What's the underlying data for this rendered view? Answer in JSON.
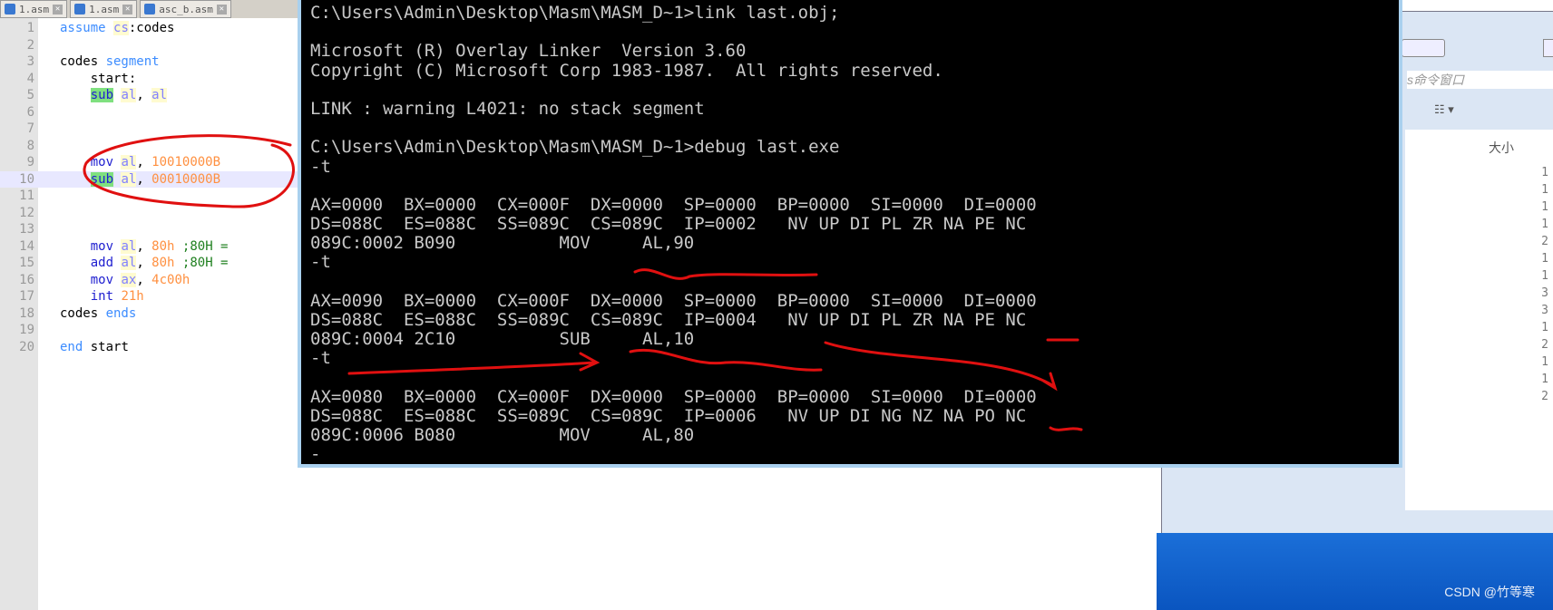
{
  "editor": {
    "tabs": [
      {
        "label": "1.asm"
      },
      {
        "label": "1.asm"
      },
      {
        "label": "asc_b.asm"
      }
    ],
    "lines": [
      {
        "n": "1",
        "html": "<span class='kw'>assume</span> <span class='reg'>cs</span>:codes"
      },
      {
        "n": "2",
        "html": ""
      },
      {
        "n": "3",
        "html": "codes <span class='kw'>segment</span>"
      },
      {
        "n": "4",
        "html": "    start:"
      },
      {
        "n": "5",
        "html": "    <span class='ins hl'>sub</span> <span class='reg'>al</span>, <span class='reg'>al</span>"
      },
      {
        "n": "6",
        "html": ""
      },
      {
        "n": "7",
        "html": ""
      },
      {
        "n": "8",
        "html": ""
      },
      {
        "n": "9",
        "html": "    <span class='ins'>mov</span> <span class='reg'>al</span>, <span class='n'>10010000B</span>"
      },
      {
        "n": "10",
        "html": "    <span class='ins hl'>sub</span> <span class='reg'>al</span>, <span class='n'>00010000B</span>"
      },
      {
        "n": "11",
        "html": ""
      },
      {
        "n": "12",
        "html": ""
      },
      {
        "n": "13",
        "html": ""
      },
      {
        "n": "14",
        "html": "    <span class='ins'>mov</span> <span class='reg'>al</span>, <span class='n'>80h</span> <span class='c'>;80H =</span>"
      },
      {
        "n": "15",
        "html": "    <span class='ins'>add</span> <span class='reg'>al</span>, <span class='n'>80h</span> <span class='c'>;80H =</span>"
      },
      {
        "n": "16",
        "html": "    <span class='ins'>mov</span> <span class='reg'>ax</span>, <span class='n'>4c00h</span>"
      },
      {
        "n": "17",
        "html": "    <span class='ins'>int</span> <span class='n'>21h</span>"
      },
      {
        "n": "18",
        "html": "codes <span class='kw'>ends</span>"
      },
      {
        "n": "19",
        "html": ""
      },
      {
        "n": "20",
        "html": "<span class='kw'>end</span> start"
      }
    ],
    "current_line": "10"
  },
  "console": {
    "lines": [
      "C:\\Users\\Admin\\Desktop\\Masm\\MASM_D~1>link last.obj;",
      "",
      "Microsoft (R) Overlay Linker  Version 3.60",
      "Copyright (C) Microsoft Corp 1983-1987.  All rights reserved.",
      "",
      "LINK : warning L4021: no stack segment",
      "",
      "C:\\Users\\Admin\\Desktop\\Masm\\MASM_D~1>debug last.exe",
      "-t",
      "",
      "AX=0000  BX=0000  CX=000F  DX=0000  SP=0000  BP=0000  SI=0000  DI=0000",
      "DS=088C  ES=088C  SS=089C  CS=089C  IP=0002   NV UP DI PL ZR NA PE NC",
      "089C:0002 B090          MOV     AL,90",
      "-t",
      "",
      "AX=0090  BX=0000  CX=000F  DX=0000  SP=0000  BP=0000  SI=0000  DI=0000",
      "DS=088C  ES=088C  SS=089C  CS=089C  IP=0004   NV UP DI PL ZR NA PE NC",
      "089C:0004 2C10          SUB     AL,10",
      "-t",
      "",
      "AX=0080  BX=0000  CX=000F  DX=0000  SP=0000  BP=0000  SI=0000  DI=0000",
      "DS=088C  ES=088C  SS=089C  CS=089C  IP=0006   NV UP DI NG NZ NA PO NC",
      "089C:0006 B080          MOV     AL,80",
      "-"
    ]
  },
  "explorer": {
    "title_fragment": "s命令窗口",
    "column_size": "大小",
    "sizes": [
      "1",
      "1",
      "1",
      "1",
      "2",
      "1",
      "1",
      "3",
      "3",
      "1",
      "2",
      "1",
      "1",
      "2"
    ]
  },
  "watermark": "CSDN @竹等寒",
  "colors": {
    "annotation": "#e01010",
    "console_bg": "#000000",
    "console_fg": "#c8c8c8"
  }
}
